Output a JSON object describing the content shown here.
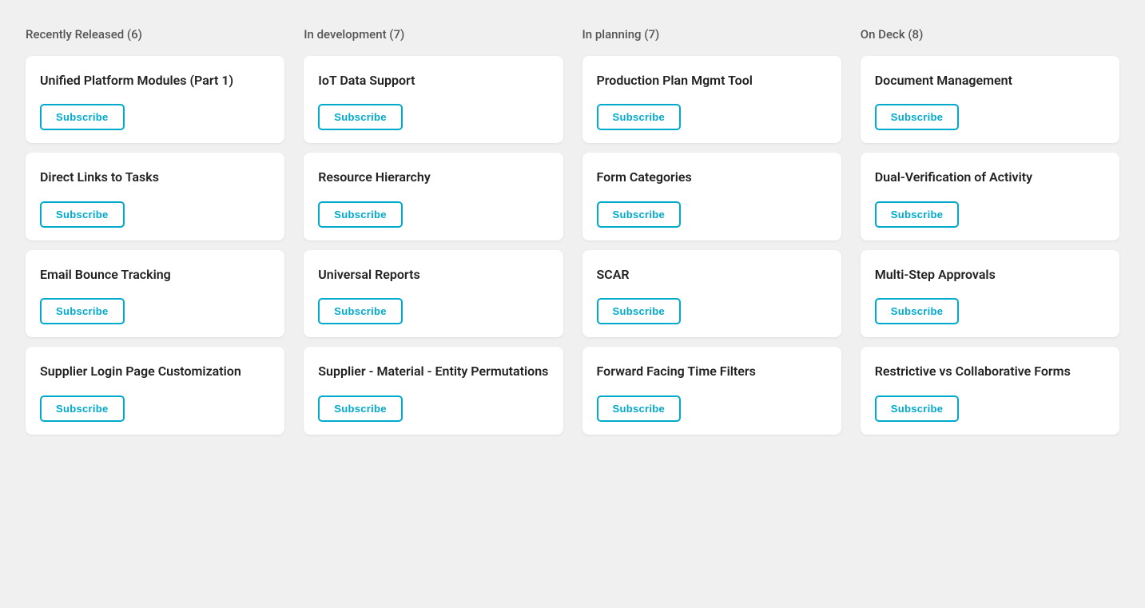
{
  "columns": [
    {
      "id": "recently-released",
      "header": "Recently Released (6)",
      "cards": [
        {
          "id": "unified-platform",
          "title": "Unified Platform Modules (Part 1)"
        },
        {
          "id": "direct-links",
          "title": "Direct Links to Tasks"
        },
        {
          "id": "email-bounce",
          "title": "Email Bounce Tracking"
        },
        {
          "id": "supplier-login",
          "title": "Supplier Login Page Customization"
        }
      ]
    },
    {
      "id": "in-development",
      "header": "In development (7)",
      "cards": [
        {
          "id": "iot-data",
          "title": "IoT Data Support"
        },
        {
          "id": "resource-hierarchy",
          "title": "Resource Hierarchy"
        },
        {
          "id": "universal-reports",
          "title": "Universal Reports"
        },
        {
          "id": "supplier-material",
          "title": "Supplier - Material - Entity Permutations"
        }
      ]
    },
    {
      "id": "in-planning",
      "header": "In planning (7)",
      "cards": [
        {
          "id": "production-plan",
          "title": "Production Plan Mgmt Tool"
        },
        {
          "id": "form-categories",
          "title": "Form Categories"
        },
        {
          "id": "scar",
          "title": "SCAR"
        },
        {
          "id": "forward-facing",
          "title": "Forward Facing Time Filters"
        }
      ]
    },
    {
      "id": "on-deck",
      "header": "On Deck (8)",
      "cards": [
        {
          "id": "document-management",
          "title": "Document Management"
        },
        {
          "id": "dual-verification",
          "title": "Dual-Verification of Activity"
        },
        {
          "id": "multi-step",
          "title": "Multi-Step Approvals"
        },
        {
          "id": "restrictive-vs",
          "title": "Restrictive vs Collaborative Forms"
        }
      ]
    }
  ],
  "subscribe_label": "Subscribe"
}
